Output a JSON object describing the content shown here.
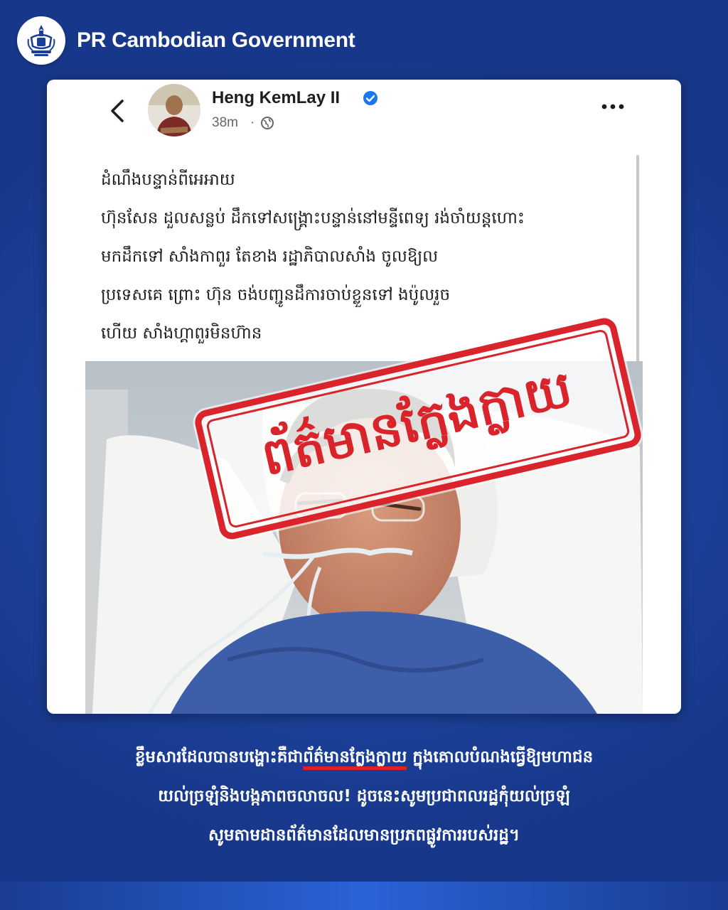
{
  "header": {
    "brand": "PR Cambodian Government",
    "logo_icon": "royal-crest-logo"
  },
  "post": {
    "author": "Heng KemLay II",
    "time": "38m",
    "separator": "·",
    "icons": {
      "back": "chevron-left-icon",
      "verified": "verified-badge-icon",
      "audience": "globe-icon",
      "more": "more-options-icon"
    },
    "text_lines": [
      "ដំណឹងបន្ទាន់ពីអេអាយ",
      "ហ៊ុនសែន ដួលសន្លប់ ដឹកទៅសង្គ្រោះបន្ទាន់នៅមន្ទីពេទ្យ រង់ចាំយន្តហោះ",
      "មកដឹកទៅ សាំងកាពួរ តែខាង រដ្ឋាភិបាលសាំង         ចូលឱ្យល",
      "ប្រទេសគេ ព្រោះ ហ៊ុន      ចង់បញ្ជូនដឹការចាប់ខ្លួនទៅ   ងប៉ូលរួច",
      "ហើយ       សាំងហ្គាពួរមិនហ៊ាន"
    ],
    "verified_color": "#1877f2"
  },
  "stamp": {
    "text": "ព័ត៌មានក្លែងក្លាយ",
    "color": "#d8242a"
  },
  "caption": {
    "line1_before": "ខ្លឹមសារដែលបានបង្ហោះគឺជា",
    "line1_highlight": "ព័ត៌មានក្លែងក្លាយ",
    "line1_after": " ក្នុងគោលបំណងធ្វើឱ្យមហាជន",
    "line2": "យល់ច្រឡំនិងបង្កភាពចលាចល! ដូចនេះសូមប្រជាពលរដ្ឋកុំយល់ច្រឡំ",
    "line3": "សូមតាមដានព័ត៌មានដែលមានប្រភពផ្លូវការរបស់រដ្ឋ។",
    "highlight_color": "#e02020"
  },
  "colors": {
    "background": "#1b3f96",
    "card": "#ffffff"
  }
}
